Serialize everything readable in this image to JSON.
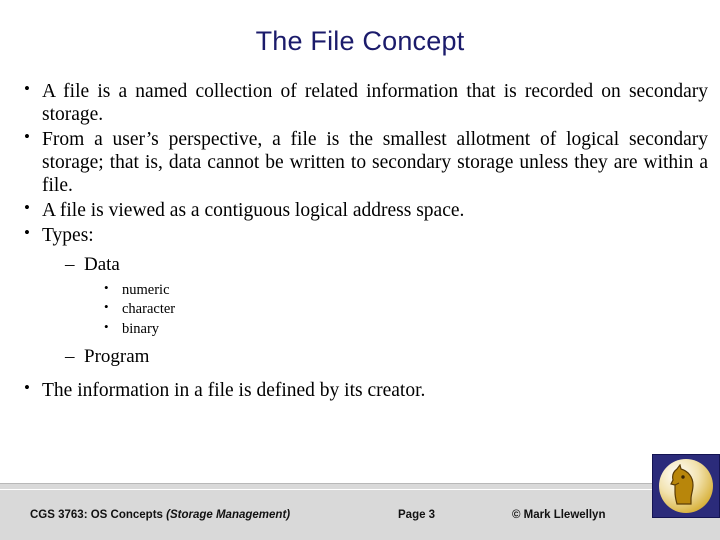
{
  "slide": {
    "title": "The File Concept",
    "bullets": [
      {
        "level": 1,
        "marker": "•",
        "text": "A file is a named collection of related information that is recorded on secondary storage.",
        "justify": true
      },
      {
        "level": 1,
        "marker": "•",
        "text": "From a user’s perspective, a file is the smallest allotment of logical secondary storage; that is, data cannot be written to secondary storage unless they are within a file.",
        "justify": true
      },
      {
        "level": 1,
        "marker": "•",
        "text": "A file is viewed as a contiguous logical address space.",
        "justify": false
      },
      {
        "level": 1,
        "marker": "•",
        "text": "Types:",
        "justify": false
      },
      {
        "level": 2,
        "marker": "–",
        "text": "Data"
      },
      {
        "level": 3,
        "marker": "•",
        "text": "numeric"
      },
      {
        "level": 3,
        "marker": "•",
        "text": "character"
      },
      {
        "level": 3,
        "marker": "•",
        "text": "binary"
      },
      {
        "level": 2,
        "marker": "–",
        "text": "Program"
      },
      {
        "level": 1,
        "marker": "•",
        "text": "The information in a file is defined by its creator.",
        "justify": false
      }
    ]
  },
  "footer": {
    "course": "CGS 3763: OS Concepts",
    "topic": "(Storage Management)",
    "page": "Page 3",
    "copyright": "© Mark Llewellyn"
  },
  "colors": {
    "title": "#1b1b6b",
    "footer_band": "#d9d9d9",
    "logo_background": "#2b2b7a",
    "logo_gold": "#d9b441"
  }
}
